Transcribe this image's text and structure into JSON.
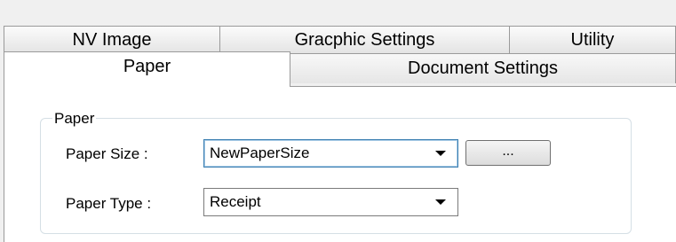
{
  "tabs_row1": [
    {
      "label": "NV Image"
    },
    {
      "label": "Gracphic Settings"
    },
    {
      "label": "Utility"
    }
  ],
  "tabs_row2": [
    {
      "label": "Paper",
      "active": true
    },
    {
      "label": "Document Settings",
      "active": false
    }
  ],
  "paper_group": {
    "legend": "Paper",
    "size_label": "Paper Size :",
    "size_value": "NewPaperSize",
    "browse_label": "...",
    "type_label": "Paper Type :",
    "type_value": "Receipt"
  }
}
